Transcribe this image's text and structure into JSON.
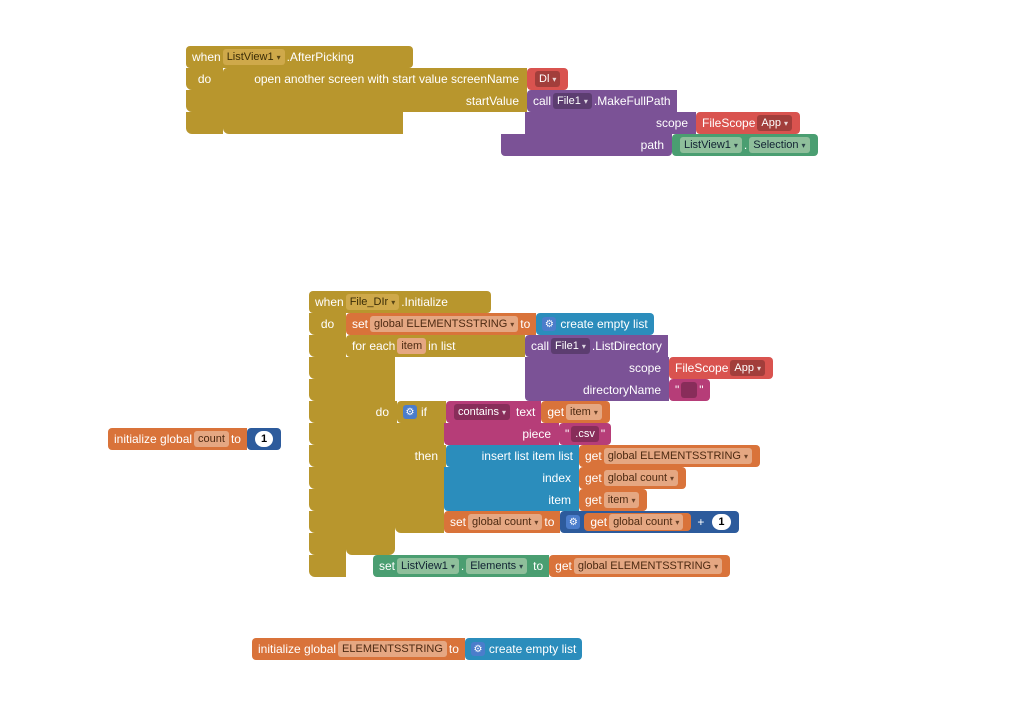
{
  "colors": {
    "olive": "#b8962d",
    "purple": "#7b5296",
    "red": "#d9534f",
    "green": "#4a9e71",
    "magenta": "#b63d78",
    "orange": "#d9733a",
    "blue": "#2b8dbc",
    "navy": "#2d5b9c"
  },
  "block1": {
    "when": "when",
    "component": "ListView1",
    "event": ".AfterPicking",
    "do": "do",
    "open": "open another screen with start value  screenName",
    "screenName_value": "Dl",
    "startValue": "startValue",
    "call": "call",
    "file": "File1",
    "makeFullPath": ".MakeFullPath",
    "scope": "scope",
    "fileScope": "FileScope",
    "app": "App",
    "path": "path",
    "listView": "ListView1",
    "dot": ".",
    "selection": "Selection"
  },
  "init_count": {
    "label": "initialize global",
    "name": "count",
    "to": "to",
    "value": "1"
  },
  "block2": {
    "when": "when",
    "component": "File_DIr",
    "event": ".Initialize",
    "do": "do",
    "set": "set",
    "var": "global ELEMENTSSTRING",
    "to": "to",
    "createEmpty": "create empty list",
    "foreach": "for each",
    "item": "item",
    "inlist": "in list",
    "call": "call",
    "file": "File1",
    "listDir": ".ListDirectory",
    "scope": "scope",
    "fileScope": "FileScope",
    "app": "App",
    "dirName": "directoryName",
    "quote": "\"",
    "quoteClose": "\"",
    "innerDo": "do",
    "if": "if",
    "contains": "contains",
    "textLbl": "text",
    "get": "get",
    "piece": "piece",
    "csv": ".csv",
    "then": "then",
    "insert": "insert list item  list",
    "index": "index",
    "itemLbl": "item",
    "globalCount": "global count",
    "plus": "+",
    "one": "1",
    "setLV": "set",
    "lv": "ListView1",
    "elements": "Elements",
    "getLbl": "get"
  },
  "init_elements": {
    "label": "initialize global",
    "name": "ELEMENTSSTRING",
    "to": "to",
    "createEmpty": "create empty list"
  }
}
